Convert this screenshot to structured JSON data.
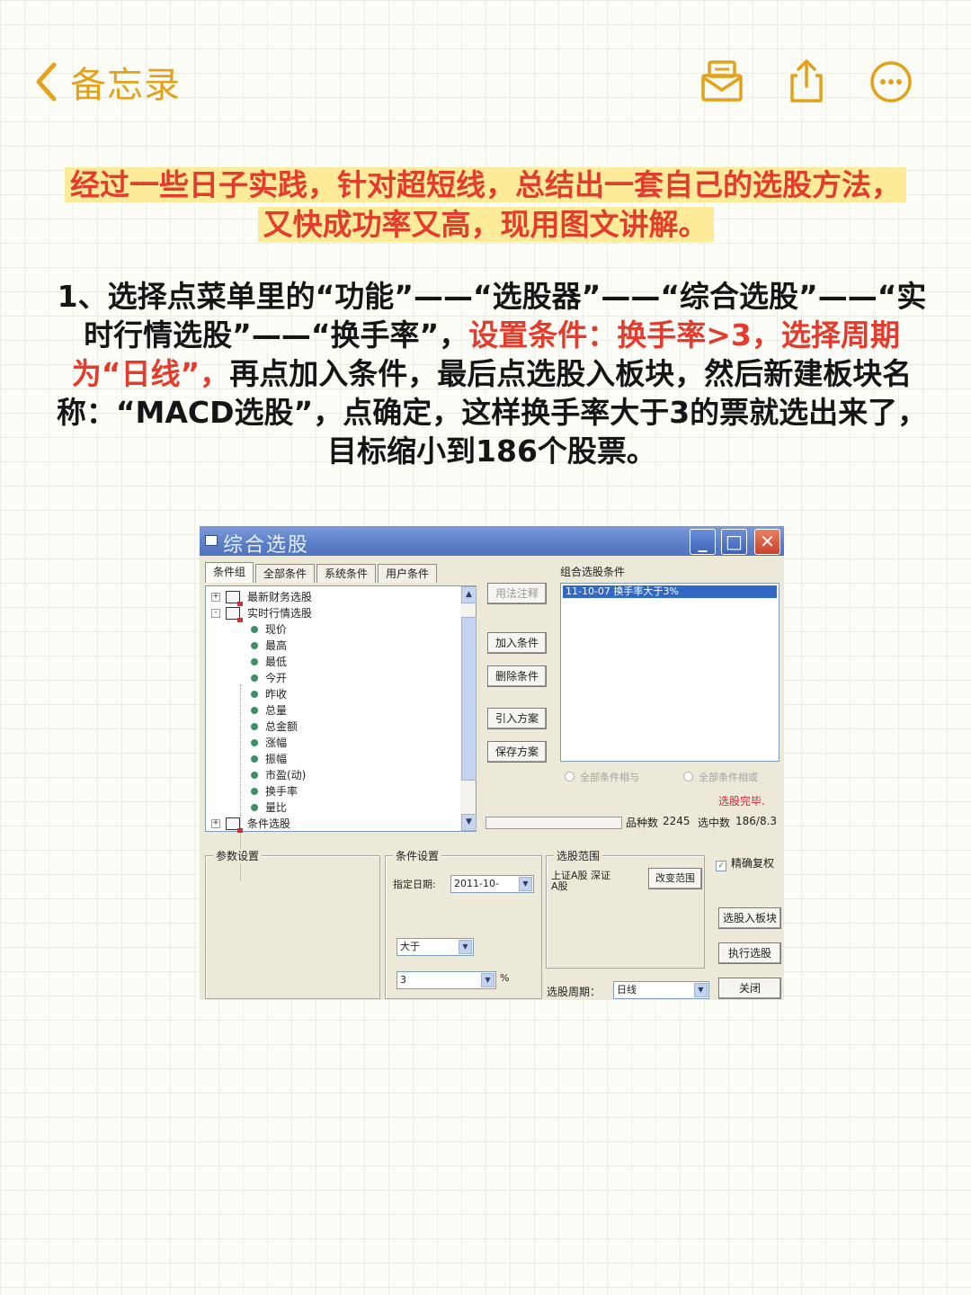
{
  "nav": {
    "back_label": "备忘录",
    "icons": [
      "chevron-left-icon",
      "envelope-icon",
      "share-icon",
      "more-icon"
    ],
    "accent": "#e3a21a"
  },
  "intro": {
    "line1": "经过一些日子实践，针对超短线，总结出一套自己的选股方法，",
    "line2": "又快成功率又高，现用图文讲解。",
    "highlight": "#fdeb9a",
    "color": "#e53b2c"
  },
  "step": {
    "part1": "1、选择点菜单里的“功能”——“选股器”——“综合选股”——“实时行情选股”——“换手率”，",
    "red": "设置条件：换手率>3，选择周期为“日线”，",
    "part2": "再点加入条件，最后点选股入板块，然后新建板块名称：“MACD选股”，点确定，这样换手率大于3的票就选出来了，目标缩小到186个股票。"
  },
  "window": {
    "title": "综合选股",
    "tabs": [
      "条件组",
      "全部条件",
      "系统条件",
      "用户条件"
    ],
    "tree": [
      {
        "label": "最新财务选股",
        "type": "folder",
        "expander": "+"
      },
      {
        "label": "实时行情选股",
        "type": "folder",
        "expander": "-"
      },
      {
        "label": "现价",
        "type": "leaf"
      },
      {
        "label": "最高",
        "type": "leaf"
      },
      {
        "label": "最低",
        "type": "leaf"
      },
      {
        "label": "今开",
        "type": "leaf"
      },
      {
        "label": "昨收",
        "type": "leaf"
      },
      {
        "label": "总量",
        "type": "leaf"
      },
      {
        "label": "总金额",
        "type": "leaf"
      },
      {
        "label": "涨幅",
        "type": "leaf"
      },
      {
        "label": "振幅",
        "type": "leaf"
      },
      {
        "label": "市盈(动)",
        "type": "leaf"
      },
      {
        "label": "换手率",
        "type": "leaf"
      },
      {
        "label": "量比",
        "type": "leaf"
      },
      {
        "label": "条件选股",
        "type": "folder",
        "expander": "+"
      }
    ],
    "combo_list_label": "组合选股条件",
    "combo_item": "11-10-07 换手率大于3%",
    "buttons": {
      "usage": "用法注释",
      "add": "加入条件",
      "delete": "删除条件",
      "import": "引入方案",
      "save": "保存方案",
      "to_block": "选股入板块",
      "execute": "执行选股",
      "close": "关闭",
      "change_range": "改变范围"
    },
    "radio_and": "全部条件相与",
    "radio_or": "全部条件相或",
    "status": "选股完毕.",
    "count_label": "品种数",
    "count_value": "2245",
    "selected_label": "选中数",
    "selected_value": "186/8.3",
    "param_label": "参数设置",
    "cond_label": "条件设置",
    "date_label": "指定日期:",
    "date_value": "2011-10-",
    "op_value": "大于",
    "threshold_value": "3",
    "percent": "%",
    "range_label": "选股范围",
    "range_text1": "上证A股 深证",
    "range_text2": "A股",
    "exact_rights": "精确复权",
    "period_label": "选股周期：",
    "period_value": "日线"
  }
}
